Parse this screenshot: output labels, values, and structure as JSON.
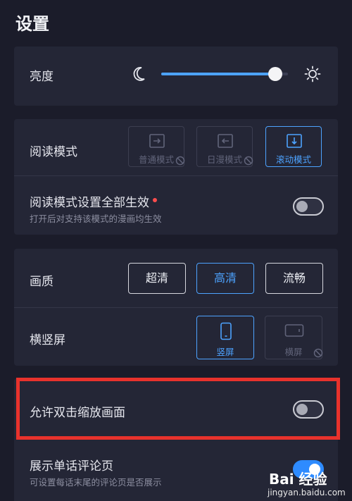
{
  "page": {
    "title": "设置"
  },
  "brightness": {
    "label": "亮度",
    "level": 0.9
  },
  "reading_mode": {
    "label": "阅读模式",
    "modes": [
      {
        "label": "普通模式",
        "icon": "arrow-right-icon",
        "state": "disabled"
      },
      {
        "label": "日漫模式",
        "icon": "arrow-left-icon",
        "state": "disabled"
      },
      {
        "label": "滚动模式",
        "icon": "arrow-down-icon",
        "state": "selected"
      }
    ],
    "apply_all": {
      "label": "阅读模式设置全部生效",
      "description": "打开后对支持该模式的漫画均生效",
      "enabled": false
    }
  },
  "quality": {
    "label": "画质",
    "options": [
      {
        "label": "超清",
        "selected": false
      },
      {
        "label": "高清",
        "selected": true
      },
      {
        "label": "流畅",
        "selected": false
      }
    ]
  },
  "orientation": {
    "label": "横竖屏",
    "options": [
      {
        "label": "竖屏",
        "icon": "phone-portrait-icon",
        "state": "selected"
      },
      {
        "label": "横屏",
        "icon": "phone-landscape-icon",
        "state": "disabled"
      }
    ]
  },
  "double_tap_zoom": {
    "label": "允许双击缩放画面",
    "enabled": false
  },
  "chapter_comments": {
    "label": "展示单话评论页",
    "description": "可设置每话末尾的评论页是否展示",
    "enabled": true
  },
  "watermark": {
    "logo": "Bai 经验",
    "site": "jingyan.baidu.com"
  },
  "colors": {
    "accent": "#4da3ff",
    "highlight": "#e8322c",
    "background": "#1b1c2a",
    "card": "#242636"
  }
}
